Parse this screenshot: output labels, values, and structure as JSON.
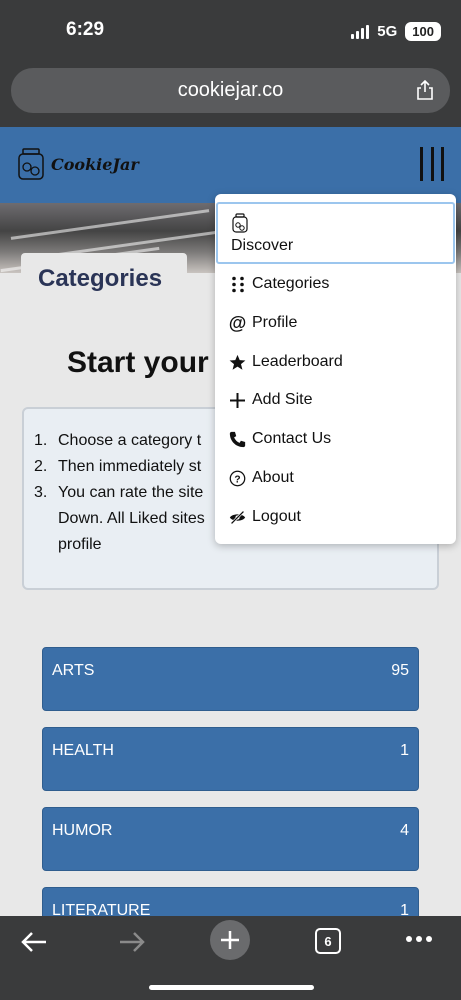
{
  "status_bar": {
    "time": "6:29",
    "network": "5G",
    "battery": "100"
  },
  "browser": {
    "url": "cookiejar.co",
    "tab_count": "6"
  },
  "site": {
    "logo_text": "CookieJar"
  },
  "categories_tab": "Categories",
  "hero_title": "Start your",
  "steps": [
    {
      "num": "1.",
      "text": "Choose a category t"
    },
    {
      "num": "2.",
      "text": "Then immediately st"
    },
    {
      "num": "3.",
      "text": "You can rate the site\nDown. All Liked sites\nprofile"
    }
  ],
  "categories": [
    {
      "name": "ARTS",
      "count": "95"
    },
    {
      "name": "HEALTH",
      "count": "1"
    },
    {
      "name": "HUMOR",
      "count": "4"
    },
    {
      "name": "LITERATURE",
      "count": "1"
    }
  ],
  "menu": {
    "discover": "Discover",
    "items": [
      {
        "label": "Categories",
        "icon": "grid-dots-icon"
      },
      {
        "label": "Profile",
        "icon": "at-icon"
      },
      {
        "label": "Leaderboard",
        "icon": "star-icon"
      },
      {
        "label": "Add Site",
        "icon": "plus-icon"
      },
      {
        "label": "Contact Us",
        "icon": "phone-icon"
      },
      {
        "label": "About",
        "icon": "question-icon"
      },
      {
        "label": "Logout",
        "icon": "eye-slash-icon"
      }
    ]
  }
}
